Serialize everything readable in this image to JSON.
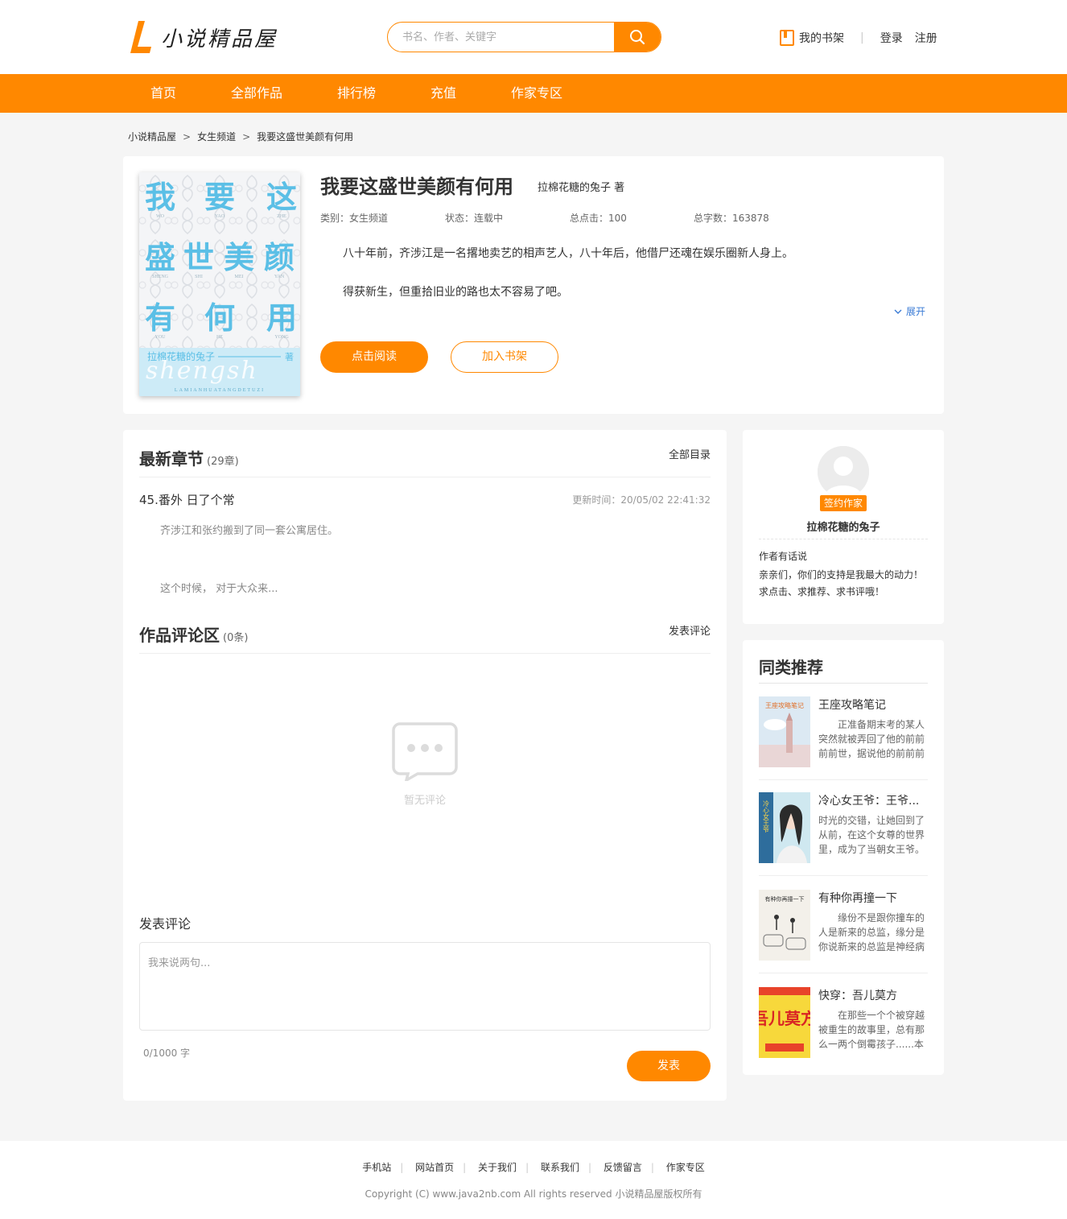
{
  "site": {
    "logo_text": "小说精品屋",
    "brand_color": "#ff8800"
  },
  "search": {
    "placeholder": "书名、作者、关键字",
    "icon": "search-icon"
  },
  "user": {
    "shelf_label": "我的书架",
    "login_label": "登录",
    "register_label": "注册"
  },
  "nav": {
    "items": [
      {
        "label": "首页"
      },
      {
        "label": "全部作品"
      },
      {
        "label": "排行榜"
      },
      {
        "label": "充值"
      },
      {
        "label": "作家专区"
      }
    ]
  },
  "breadcrumb": {
    "items": [
      "小说精品屋",
      "女生频道",
      "我要这盛世美颜有何用"
    ],
    "separator": ">"
  },
  "book": {
    "title": "我要这盛世美颜有何用",
    "author_line": "拉棉花糖的兔子 著",
    "cover": {
      "row1": [
        "我",
        "要",
        "这"
      ],
      "row1_pinyin": [
        "WO",
        "YAO",
        "ZHE"
      ],
      "row2": [
        "盛",
        "世",
        "美",
        "颜"
      ],
      "row2_pinyin": [
        "SHENG",
        "SHI",
        "MEI",
        "YAN"
      ],
      "row3": [
        "有",
        "何",
        "用"
      ],
      "row3_pinyin": [
        "YOU",
        "HE",
        "YONG"
      ],
      "author_mark": "拉棉花糖的兔子",
      "author_suffix": "著",
      "script_text": "shengsh",
      "bottom_text": "LAMIANHUATANGDETUZI"
    },
    "category": "类别：女生频道",
    "status": "状态：连载中",
    "clicks": "总点击：100",
    "words": "总字数：163878",
    "intro": [
      "八十年前，齐涉江是一名撂地卖艺的相声艺人，八十年后，他借尸还魂在娱乐圈新人身上。",
      "得获新生，但重拾旧业的路也太不容易了吧。"
    ],
    "expand_label": "展开",
    "read_button": "点击阅读",
    "shelf_button": "加入书架"
  },
  "chapters": {
    "title": "最新章节",
    "count": "(29章)",
    "all_link": "全部目录",
    "latest_name": "45.番外 日了个常",
    "update_time": "更新时间：20/05/02 22:41:32",
    "excerpt": [
      "齐涉江和张约搬到了同一套公寓居住。",
      "这个时候， 对于大众来..."
    ]
  },
  "comments": {
    "title": "作品评论区",
    "count": "(0条)",
    "post_link": "发表评论",
    "empty_text": "暂无评论",
    "form_label": "发表评论",
    "textarea_placeholder": "我来说两句...",
    "char_count": "0/1000 字",
    "submit_label": "发表"
  },
  "author": {
    "badge": "签约作家",
    "name": "拉棉花糖的兔子",
    "say_label": "作者有话说",
    "say_text": "亲亲们，你们的支持是我最大的动力！求点击、求推荐、求书评哦！"
  },
  "recommend": {
    "title": "同类推荐",
    "items": [
      {
        "name": "王座攻略笔记",
        "desc": "正准备期末考的某人突然就被弄回了他的前前前前世，据说他的前前前",
        "cover_text": "王座攻略笔记"
      },
      {
        "name": "冷心女王爷：王爷...",
        "desc": "时光的交错，让她回到了从前，在这个女尊的世界里，成为了当朝女王爷。",
        "cover_text": "冷心女王爷"
      },
      {
        "name": "有种你再撞一下",
        "desc": "缘份不是跟你撞车的人是新来的总监，缘分是你说新来的总监是神经病",
        "cover_text": "有种你再撞一下"
      },
      {
        "name": "快穿：吾儿莫方",
        "desc": "在那些一个个被穿越被重生的故事里，总有那么一两个倒霉孩子......本",
        "cover_text": "吾儿莫方"
      }
    ]
  },
  "footer": {
    "links": [
      "手机站",
      "网站首页",
      "关于我们",
      "联系我们",
      "反馈留言",
      "作家专区"
    ],
    "copyright": "Copyright (C) www.java2nb.com All rights reserved 小说精品屋版权所有"
  }
}
